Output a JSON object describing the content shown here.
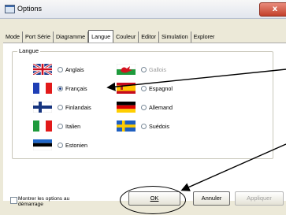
{
  "window": {
    "title": "Options",
    "close_glyph": "x"
  },
  "tabs": [
    {
      "label": "Mode"
    },
    {
      "label": "Port Série"
    },
    {
      "label": "Diagramme"
    },
    {
      "label": "Langue",
      "active": true
    },
    {
      "label": "Couleur"
    },
    {
      "label": "Editor"
    },
    {
      "label": "Simulation"
    },
    {
      "label": "Explorer"
    }
  ],
  "group": {
    "label": "Langue"
  },
  "languages": [
    {
      "label": "Anglais",
      "flag": "uk",
      "selected": false,
      "enabled": true
    },
    {
      "label": "Français",
      "flag": "france",
      "selected": true,
      "enabled": true
    },
    {
      "label": "Finlandais",
      "flag": "finland",
      "selected": false,
      "enabled": true
    },
    {
      "label": "Italien",
      "flag": "italy",
      "selected": false,
      "enabled": true
    },
    {
      "label": "Estonien",
      "flag": "estonia",
      "selected": false,
      "enabled": true
    },
    {
      "label": "Gallois",
      "flag": "wales",
      "selected": false,
      "enabled": false
    },
    {
      "label": "Espagnol",
      "flag": "spain",
      "selected": false,
      "enabled": true
    },
    {
      "label": "Allemand",
      "flag": "germany",
      "selected": false,
      "enabled": true
    },
    {
      "label": "Suédois",
      "flag": "sweden",
      "selected": false,
      "enabled": true
    }
  ],
  "footer": {
    "checkbox_label_line1": "Montrer les options au",
    "checkbox_label_line2": "démarrage",
    "ok_label": "OK",
    "cancel_label": "Annuler",
    "apply_label": "Appliquer"
  },
  "colors": {
    "dialog_bg": "#ece9d8",
    "content_bg": "#ffffff",
    "radio_dot": "#1a3d8a"
  }
}
